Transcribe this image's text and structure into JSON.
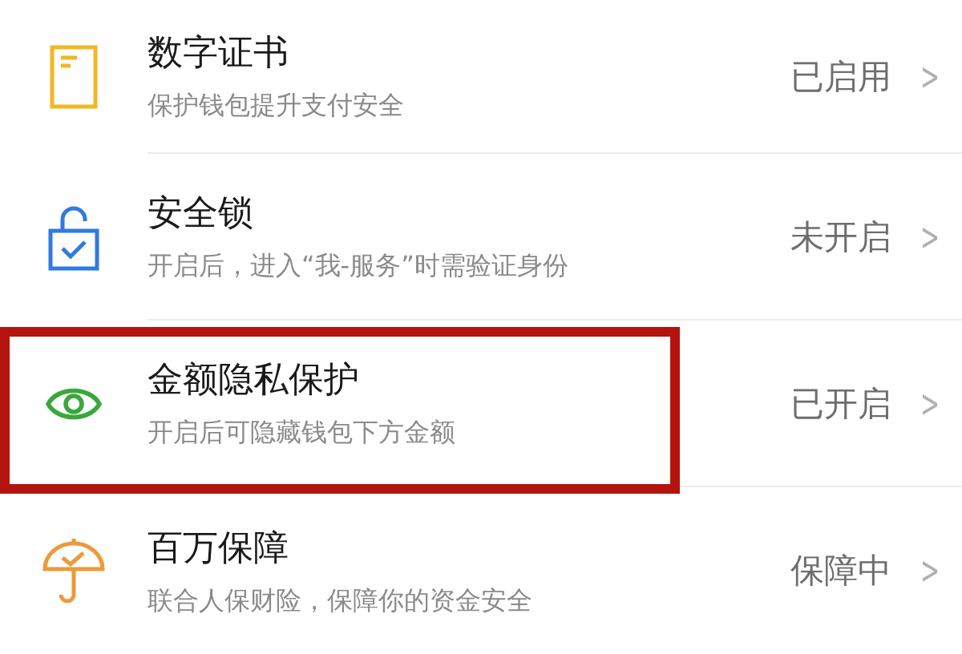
{
  "rows": [
    {
      "kind": "certificate",
      "title": "数字证书",
      "subtitle": "保护钱包提升支付安全",
      "status": "已启用",
      "chevron": ">",
      "highlighted": false
    },
    {
      "kind": "lock",
      "title": "安全锁",
      "subtitle": "开启后，进入“我-服务”时需验证身份",
      "status": "未开启",
      "chevron": ">",
      "highlighted": false
    },
    {
      "kind": "eye",
      "title": "金额隐私保护",
      "subtitle": "开启后可隐藏钱包下方金额",
      "status": "已开启",
      "chevron": ">",
      "highlighted": true
    },
    {
      "kind": "umbrella",
      "title": "百万保障",
      "subtitle": "联合人保财险，保障你的资金安全",
      "status": "保障中",
      "chevron": ">",
      "highlighted": false
    }
  ]
}
